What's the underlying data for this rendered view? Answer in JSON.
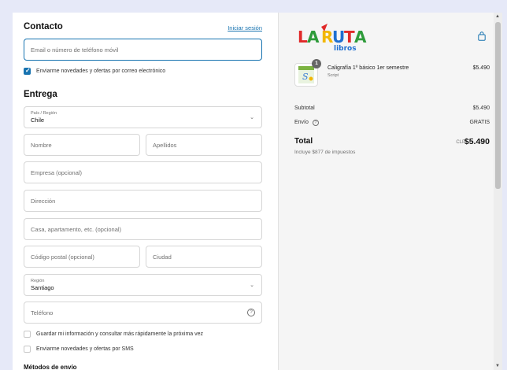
{
  "contact": {
    "heading": "Contacto",
    "login_link": "Iniciar sesión",
    "email_placeholder": "Email o número de teléfono móvil",
    "newsletter_label": "Enviarme novedades y ofertas por correo electrónico",
    "newsletter_checked": true
  },
  "delivery": {
    "heading": "Entrega",
    "country_label": "País / Región",
    "country_value": "Chile",
    "first_name_placeholder": "Nombre",
    "last_name_placeholder": "Apellidos",
    "company_placeholder": "Empresa (opcional)",
    "address_placeholder": "Dirección",
    "apartment_placeholder": "Casa, apartamento, etc. (opcional)",
    "postal_placeholder": "Código postal (opcional)",
    "city_placeholder": "Ciudad",
    "region_label": "Región",
    "region_value": "Santiago",
    "phone_placeholder": "Teléfono",
    "save_info_label": "Guardar mi información y consultar más rápidamente la próxima vez",
    "sms_label": "Enviarme novedades y ofertas por SMS"
  },
  "shipping": {
    "heading": "Métodos de envío"
  },
  "brand": {
    "logo_main": "LA RUTA",
    "logo_sub": "libros",
    "colors": [
      "#e02a2a",
      "#f2b705",
      "#2e9b3a",
      "#1e6fd1"
    ]
  },
  "summary": {
    "product_name": "Caligrafía 1º básico 1er semestre",
    "product_variant": "Script",
    "product_price": "$5.490",
    "quantity": "1",
    "subtotal_label": "Subtotal",
    "subtotal_value": "$5.490",
    "shipping_label": "Envío",
    "shipping_value": "GRATIS",
    "total_label": "Total",
    "currency": "CLP",
    "total_value": "$5.490",
    "tax_note": "Incluye $877 de impuestos"
  },
  "icons": {
    "chevron": "chevron-down-icon",
    "help": "question-circle-icon",
    "bag": "shopping-bag-icon"
  },
  "accent_color": "#1773b0"
}
